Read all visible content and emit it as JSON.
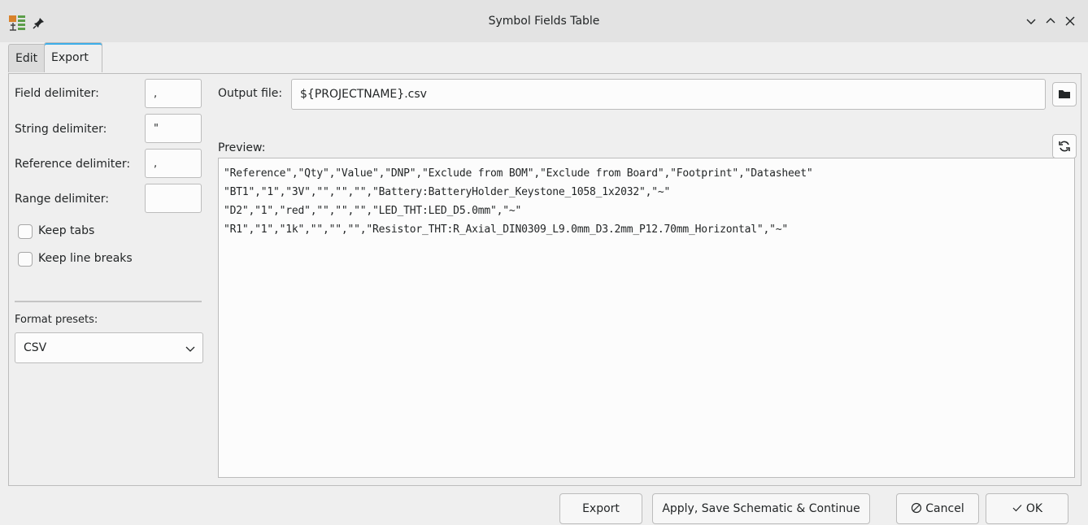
{
  "window": {
    "title": "Symbol Fields Table"
  },
  "tabs": [
    {
      "label": "Edit"
    },
    {
      "label": "Export"
    }
  ],
  "left": {
    "field_delimiter_label": "Field delimiter:",
    "field_delimiter_value": ",",
    "string_delimiter_label": "String delimiter:",
    "string_delimiter_value": "\"",
    "reference_delimiter_label": "Reference delimiter:",
    "reference_delimiter_value": ",",
    "range_delimiter_label": "Range delimiter:",
    "range_delimiter_value": "",
    "keep_tabs_label": "Keep tabs",
    "keep_tabs_checked": false,
    "keep_line_breaks_label": "Keep line breaks",
    "keep_line_breaks_checked": false,
    "format_presets_label": "Format presets:",
    "format_presets_value": "CSV"
  },
  "right": {
    "output_file_label": "Output file:",
    "output_file_value": "${PROJECTNAME}.csv",
    "preview_label": "Preview:",
    "preview_lines": [
      "\"Reference\",\"Qty\",\"Value\",\"DNP\",\"Exclude from BOM\",\"Exclude from Board\",\"Footprint\",\"Datasheet\"",
      "\"BT1\",\"1\",\"3V\",\"\",\"\",\"\",\"Battery:BatteryHolder_Keystone_1058_1x2032\",\"~\"",
      "\"D2\",\"1\",\"red\",\"\",\"\",\"\",\"LED_THT:LED_D5.0mm\",\"~\"",
      "\"R1\",\"1\",\"1k\",\"\",\"\",\"\",\"Resistor_THT:R_Axial_DIN0309_L9.0mm_D3.2mm_P12.70mm_Horizontal\",\"~\""
    ]
  },
  "buttons": {
    "export": "Export",
    "apply": "Apply, Save Schematic & Continue",
    "cancel": "Cancel",
    "ok": "OK"
  },
  "icons": {
    "app": "kicad-symbol-fields-icon",
    "pin": "pin-icon",
    "minimize": "chevron-down-icon",
    "maximize": "chevron-up-icon",
    "close": "close-icon",
    "browse": "folder-icon",
    "refresh": "refresh-icon",
    "combo": "chevron-down-icon",
    "cancel": "cancel-icon",
    "ok": "check-icon"
  },
  "colors": {
    "tab_accent": "#3daee9",
    "app_icon_orange": "#d9822b",
    "app_icon_green": "#5c9e4a"
  }
}
